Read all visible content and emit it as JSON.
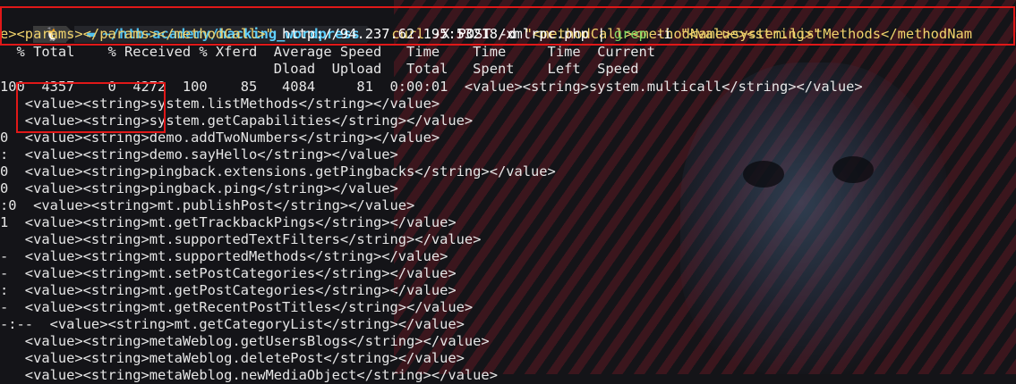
{
  "prompt": {
    "os_glyph": "🐧",
    "folder_glyph": "▬",
    "path_prefix": "~/htb-academy/",
    "path_dir": "hacking_wordpress"
  },
  "command": {
    "line1_curl": "curl",
    "line1_rest": " -X POST -d ",
    "line1_arg": "\"<methodCall><methodName>system.listMethods</methodNam",
    "line2_arg": "e><params></params></methodCall>\"",
    "line2_url": " http://94.237.62.195:53218/xmlrpc.php ",
    "line2_pipe": "| ",
    "line2_grep": "grep",
    "line2_grep_args": " -i ",
    "line2_grep_pattern": "\"<value><string>\""
  },
  "curl_progress": {
    "header1": "  % Total    % Received % Xferd  Average Speed   Time    Time     Time  Current",
    "header2": "                                 Dload  Upload   Total   Spent    Left  Speed",
    "row": "100  4357    0  4272  100    85   4084     81  0:00:01  <value><string>system.multicall</string></value>"
  },
  "output_lines": [
    "   <value><string>system.listMethods</string></value>",
    "   <value><string>system.getCapabilities</string></value>",
    "0  <value><string>demo.addTwoNumbers</string></value>",
    ":  <value><string>demo.sayHello</string></value>",
    "0  <value><string>pingback.extensions.getPingbacks</string></value>",
    "0  <value><string>pingback.ping</string></value>",
    ":0  <value><string>mt.publishPost</string></value>",
    "1  <value><string>mt.getTrackbackPings</string></value>",
    "   <value><string>mt.supportedTextFilters</string></value>",
    "-  <value><string>mt.supportedMethods</string></value>",
    "-  <value><string>mt.setPostCategories</string></value>",
    ":  <value><string>mt.getPostCategories</string></value>",
    "-  <value><string>mt.getRecentPostTitles</string></value>",
    "-:--  <value><string>mt.getCategoryList</string></value>",
    "   <value><string>metaWeblog.getUsersBlogs</string></value>",
    "   <value><string>metaWeblog.deletePost</string></value>",
    "   <value><string>metaWeblog.newMediaObject</string></value>"
  ],
  "colors": {
    "highlight_box": "#e01818",
    "prompt_path": "#4fc0f0",
    "command_keyword": "#f0d36c",
    "grep_keyword": "#7fd962"
  }
}
